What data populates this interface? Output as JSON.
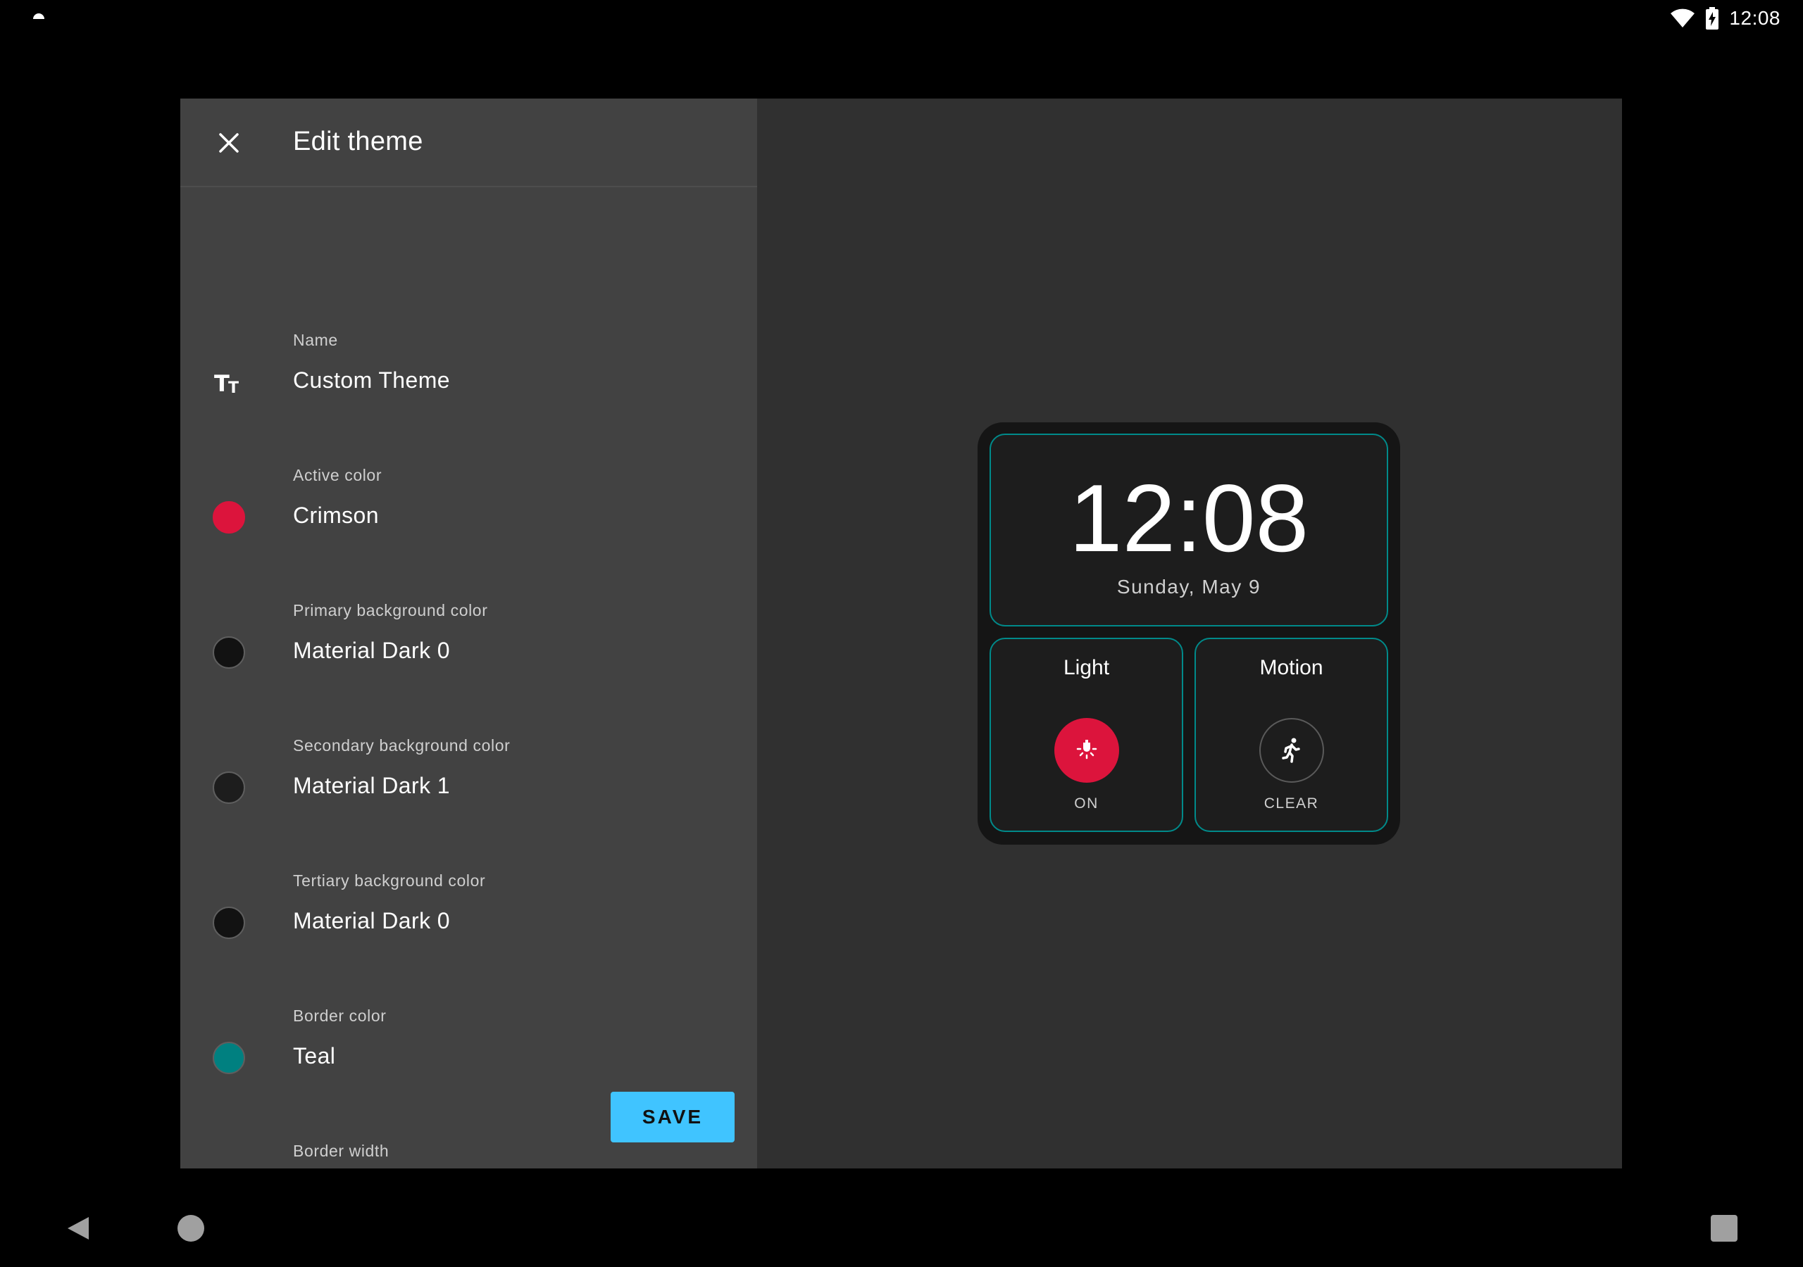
{
  "status_bar": {
    "time": "12:08"
  },
  "dialog": {
    "title": "Edit theme",
    "save_label": "SAVE",
    "settings": [
      {
        "label": "Name",
        "value": "Custom Theme",
        "icon": "text-size-icon"
      },
      {
        "label": "Active color",
        "value": "Crimson",
        "color": "#dc143c"
      },
      {
        "label": "Primary background color",
        "value": "Material Dark 0",
        "color": "#121212"
      },
      {
        "label": "Secondary background color",
        "value": "Material Dark 1",
        "color": "#1d1d1d"
      },
      {
        "label": "Tertiary background color",
        "value": "Material Dark 0",
        "color": "#121212"
      },
      {
        "label": "Border color",
        "value": "Teal",
        "color": "#008080"
      },
      {
        "label": "Border width"
      }
    ]
  },
  "preview": {
    "clock": {
      "time": "12:08",
      "date": "Sunday, May 9"
    },
    "tiles": [
      {
        "title": "Light",
        "status": "ON",
        "icon": "lightbulb-icon",
        "active": true
      },
      {
        "title": "Motion",
        "status": "CLEAR",
        "icon": "run-icon",
        "active": false
      }
    ]
  },
  "colors": {
    "accent": "#40c4ff",
    "active": "#dc143c",
    "border": "#008a8a",
    "panel": "#424242",
    "background": "#303030"
  }
}
